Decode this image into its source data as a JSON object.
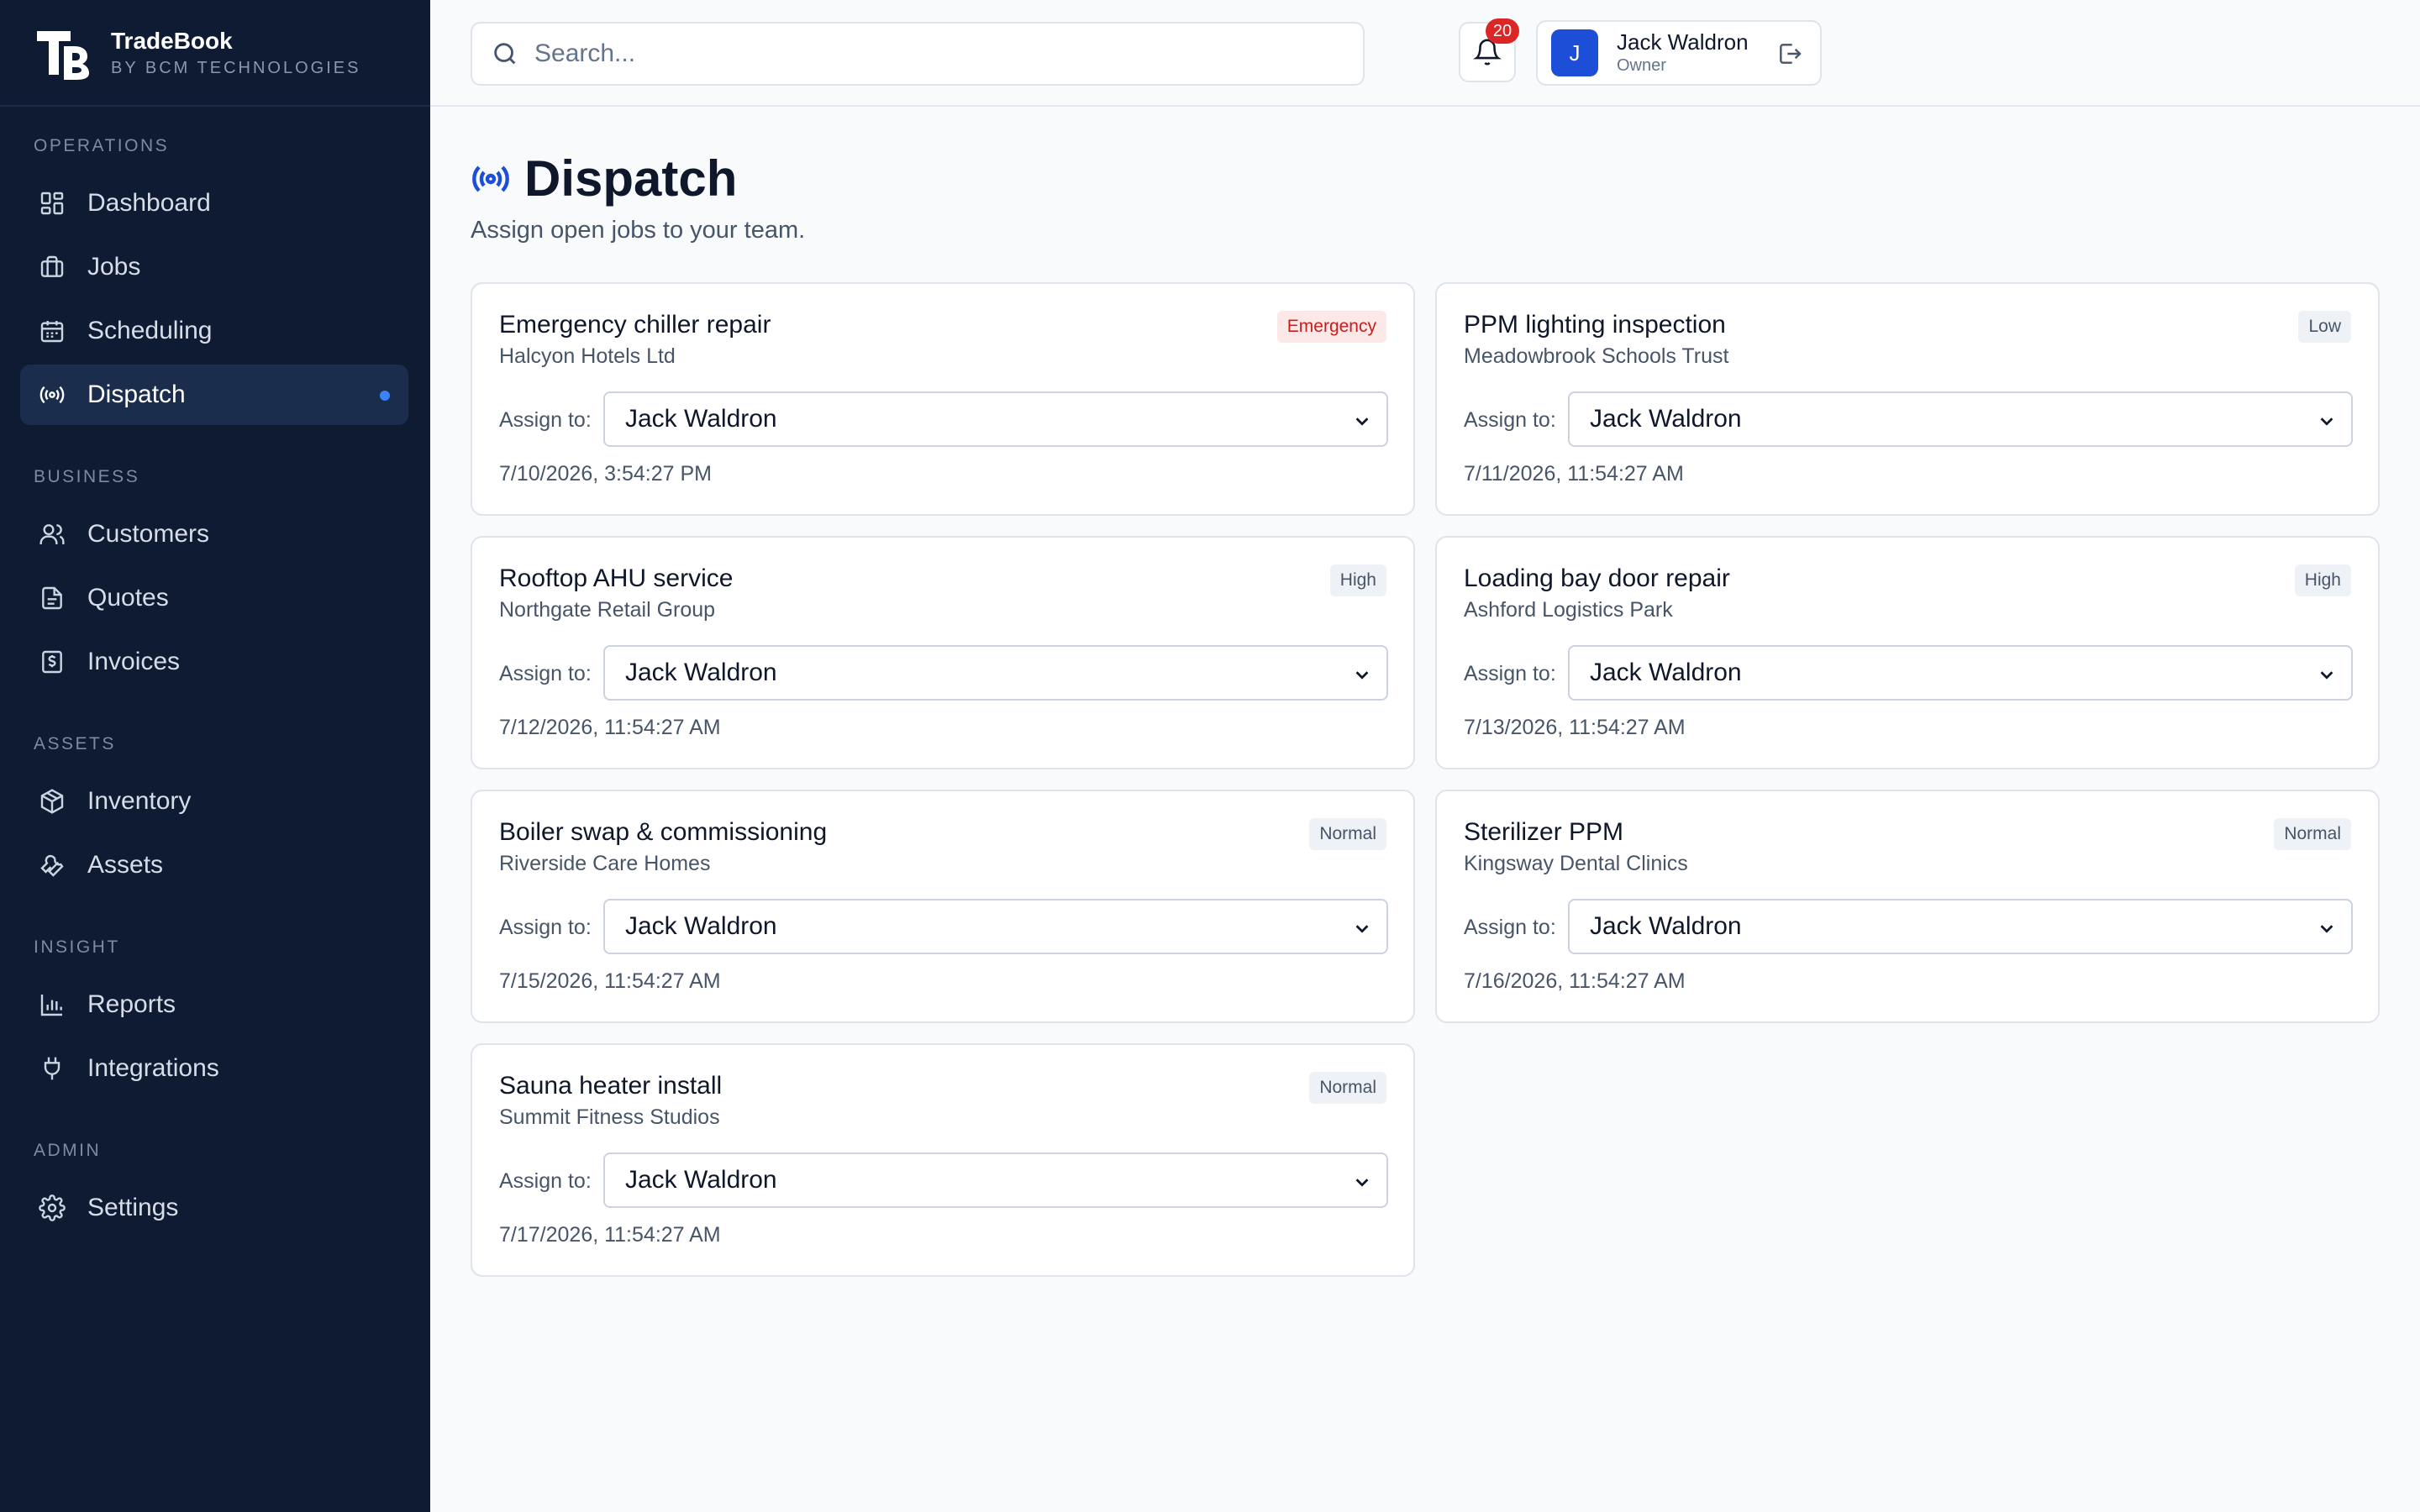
{
  "brand": {
    "name": "TradeBook",
    "subtitle": "BY BCM TECHNOLOGIES"
  },
  "sidebar": {
    "sections": [
      {
        "label": "OPERATIONS",
        "items": [
          {
            "label": "Dashboard",
            "icon": "dashboard-icon"
          },
          {
            "label": "Jobs",
            "icon": "briefcase-icon"
          },
          {
            "label": "Scheduling",
            "icon": "calendar-icon"
          },
          {
            "label": "Dispatch",
            "icon": "broadcast-icon",
            "active": true
          }
        ]
      },
      {
        "label": "BUSINESS",
        "items": [
          {
            "label": "Customers",
            "icon": "users-icon"
          },
          {
            "label": "Quotes",
            "icon": "document-icon"
          },
          {
            "label": "Invoices",
            "icon": "invoice-icon"
          }
        ]
      },
      {
        "label": "ASSETS",
        "items": [
          {
            "label": "Inventory",
            "icon": "box-icon"
          },
          {
            "label": "Assets",
            "icon": "wrench-icon"
          }
        ]
      },
      {
        "label": "INSIGHT",
        "items": [
          {
            "label": "Reports",
            "icon": "bar-chart-icon"
          },
          {
            "label": "Integrations",
            "icon": "plug-icon"
          }
        ]
      },
      {
        "label": "ADMIN",
        "items": [
          {
            "label": "Settings",
            "icon": "gear-icon"
          }
        ]
      }
    ]
  },
  "header": {
    "search_placeholder": "Search...",
    "notifications_count": "20",
    "user": {
      "initial": "J",
      "name": "Jack Waldron",
      "role": "Owner"
    }
  },
  "page": {
    "title": "Dispatch",
    "subtitle": "Assign open jobs to your team."
  },
  "jobs": [
    {
      "title": "Emergency chiller repair",
      "customer": "Halcyon Hotels Ltd",
      "priority": "Emergency",
      "assign_label": "Assign to:",
      "assignee": "Jack Waldron",
      "date": "7/10/2026, 3:54:27 PM"
    },
    {
      "title": "PPM lighting inspection",
      "customer": "Meadowbrook Schools Trust",
      "priority": "Low",
      "assign_label": "Assign to:",
      "assignee": "Jack Waldron",
      "date": "7/11/2026, 11:54:27 AM"
    },
    {
      "title": "Rooftop AHU service",
      "customer": "Northgate Retail Group",
      "priority": "High",
      "assign_label": "Assign to:",
      "assignee": "Jack Waldron",
      "date": "7/12/2026, 11:54:27 AM"
    },
    {
      "title": "Loading bay door repair",
      "customer": "Ashford Logistics Park",
      "priority": "High",
      "assign_label": "Assign to:",
      "assignee": "Jack Waldron",
      "date": "7/13/2026, 11:54:27 AM"
    },
    {
      "title": "Boiler swap & commissioning",
      "customer": "Riverside Care Homes",
      "priority": "Normal",
      "assign_label": "Assign to:",
      "assignee": "Jack Waldron",
      "date": "7/15/2026, 11:54:27 AM"
    },
    {
      "title": "Sterilizer PPM",
      "customer": "Kingsway Dental Clinics",
      "priority": "Normal",
      "assign_label": "Assign to:",
      "assignee": "Jack Waldron",
      "date": "7/16/2026, 11:54:27 AM"
    },
    {
      "title": "Sauna heater install",
      "customer": "Summit Fitness Studios",
      "priority": "Normal",
      "assign_label": "Assign to:",
      "assignee": "Jack Waldron",
      "date": "7/17/2026, 11:54:27 AM"
    }
  ],
  "colors": {
    "sidebar_bg": "#0f1b33",
    "accent": "#1d4ed8",
    "emergency": "#c81e1e"
  }
}
